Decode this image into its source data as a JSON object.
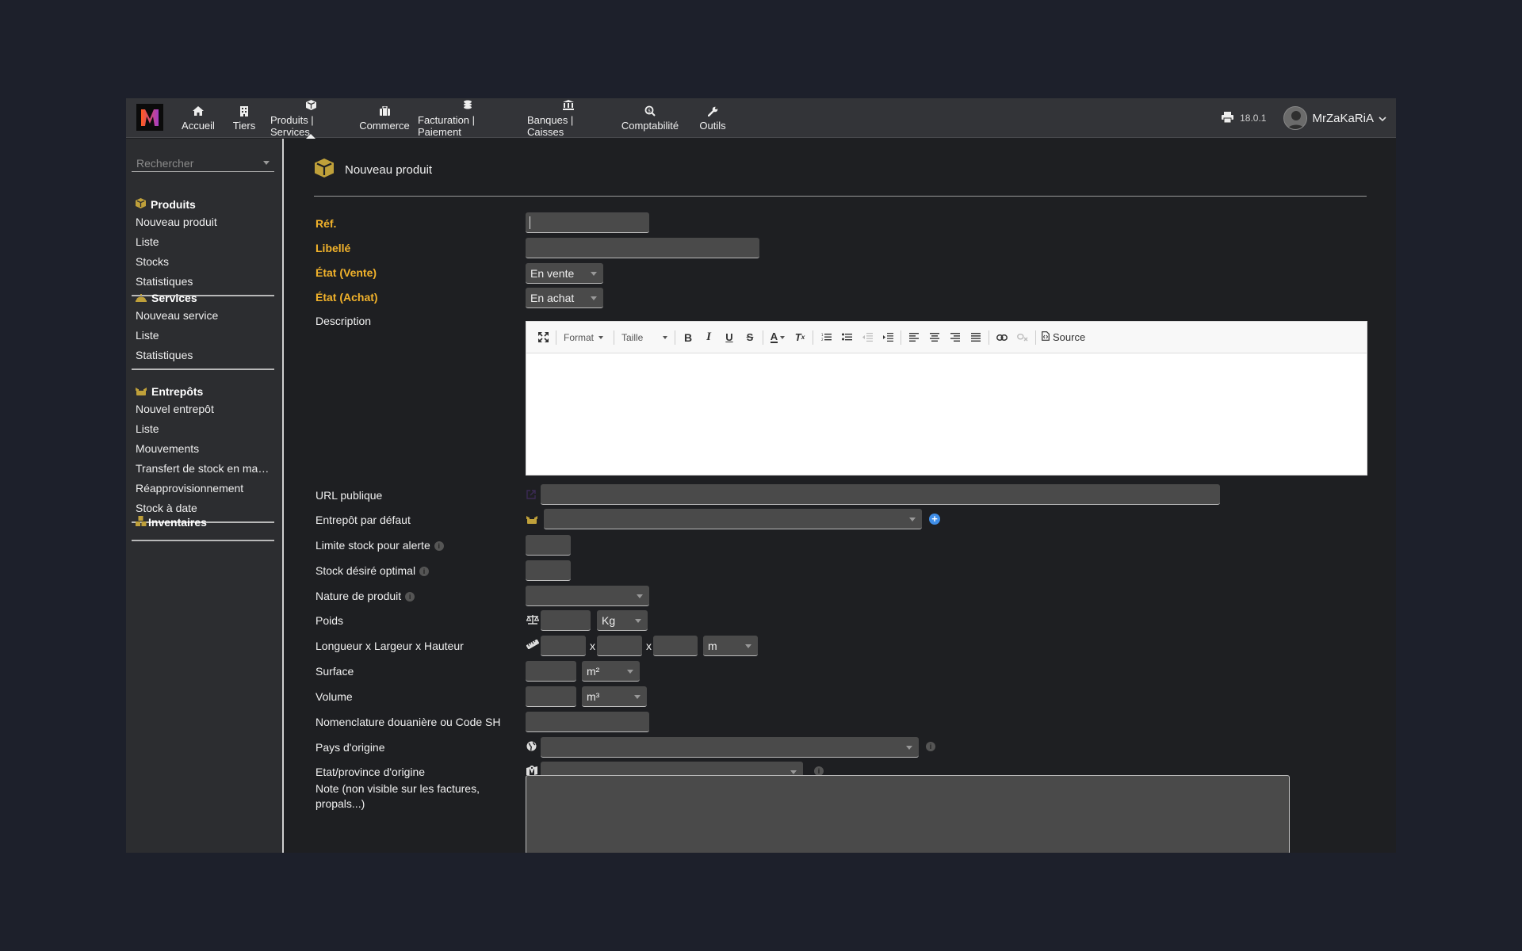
{
  "topbar": {
    "menu": [
      {
        "label": "Accueil",
        "icon": "home-icon"
      },
      {
        "label": "Tiers",
        "icon": "building-icon"
      },
      {
        "label": "Produits | Services",
        "icon": "cube-icon",
        "active": true
      },
      {
        "label": "Commerce",
        "icon": "suitcase-icon"
      },
      {
        "label": "Facturation | Paiement",
        "icon": "coins-icon"
      },
      {
        "label": "Banques | Caisses",
        "icon": "bank-icon"
      },
      {
        "label": "Comptabilité",
        "icon": "search-dollar-icon"
      },
      {
        "label": "Outils",
        "icon": "wrench-icon"
      }
    ],
    "version": "18.0.1",
    "username": "MrZaKaRiA"
  },
  "sidebar": {
    "search_placeholder": "Rechercher",
    "sections": [
      {
        "title": "Produits",
        "icon": "cube-icon",
        "links": [
          "Nouveau produit",
          "Liste",
          "Stocks",
          "Statistiques"
        ]
      },
      {
        "title": "Services",
        "icon": "bell-icon",
        "links": [
          "Nouveau service",
          "Liste",
          "Statistiques"
        ]
      },
      {
        "title": "Entrepôts",
        "icon": "warehouse-icon",
        "links": [
          "Nouvel entrepôt",
          "Liste",
          "Mouvements",
          "Transfert de stock en ma…",
          "Réapprovisionnement",
          "Stock à date"
        ]
      },
      {
        "title": "Inventaires",
        "icon": "boxes-icon",
        "links": []
      }
    ]
  },
  "page": {
    "title": "Nouveau produit",
    "labels": {
      "ref": "Réf.",
      "libelle": "Libellé",
      "etat_vente": "État (Vente)",
      "etat_achat": "État (Achat)",
      "description": "Description",
      "url": "URL publique",
      "entrepot": "Entrepôt par défaut",
      "limite": "Limite stock pour alerte",
      "optimal": "Stock désiré optimal",
      "nature": "Nature de produit",
      "poids": "Poids",
      "dims": "Longueur x Largeur x Hauteur",
      "surface": "Surface",
      "volume": "Volume",
      "nomenclature": "Nomenclature douanière ou Code SH",
      "pays": "Pays d'origine",
      "province": "Etat/province d'origine",
      "note": "Note (non visible sur les factures, propals...)"
    },
    "values": {
      "etat_vente": "En vente",
      "etat_achat": "En achat",
      "poids_unit": "Kg",
      "dims_unit": "m",
      "surface_unit": "m²",
      "volume_unit": "m³",
      "times": "x"
    },
    "editor": {
      "format": "Format",
      "taille": "Taille",
      "source": "Source"
    }
  }
}
